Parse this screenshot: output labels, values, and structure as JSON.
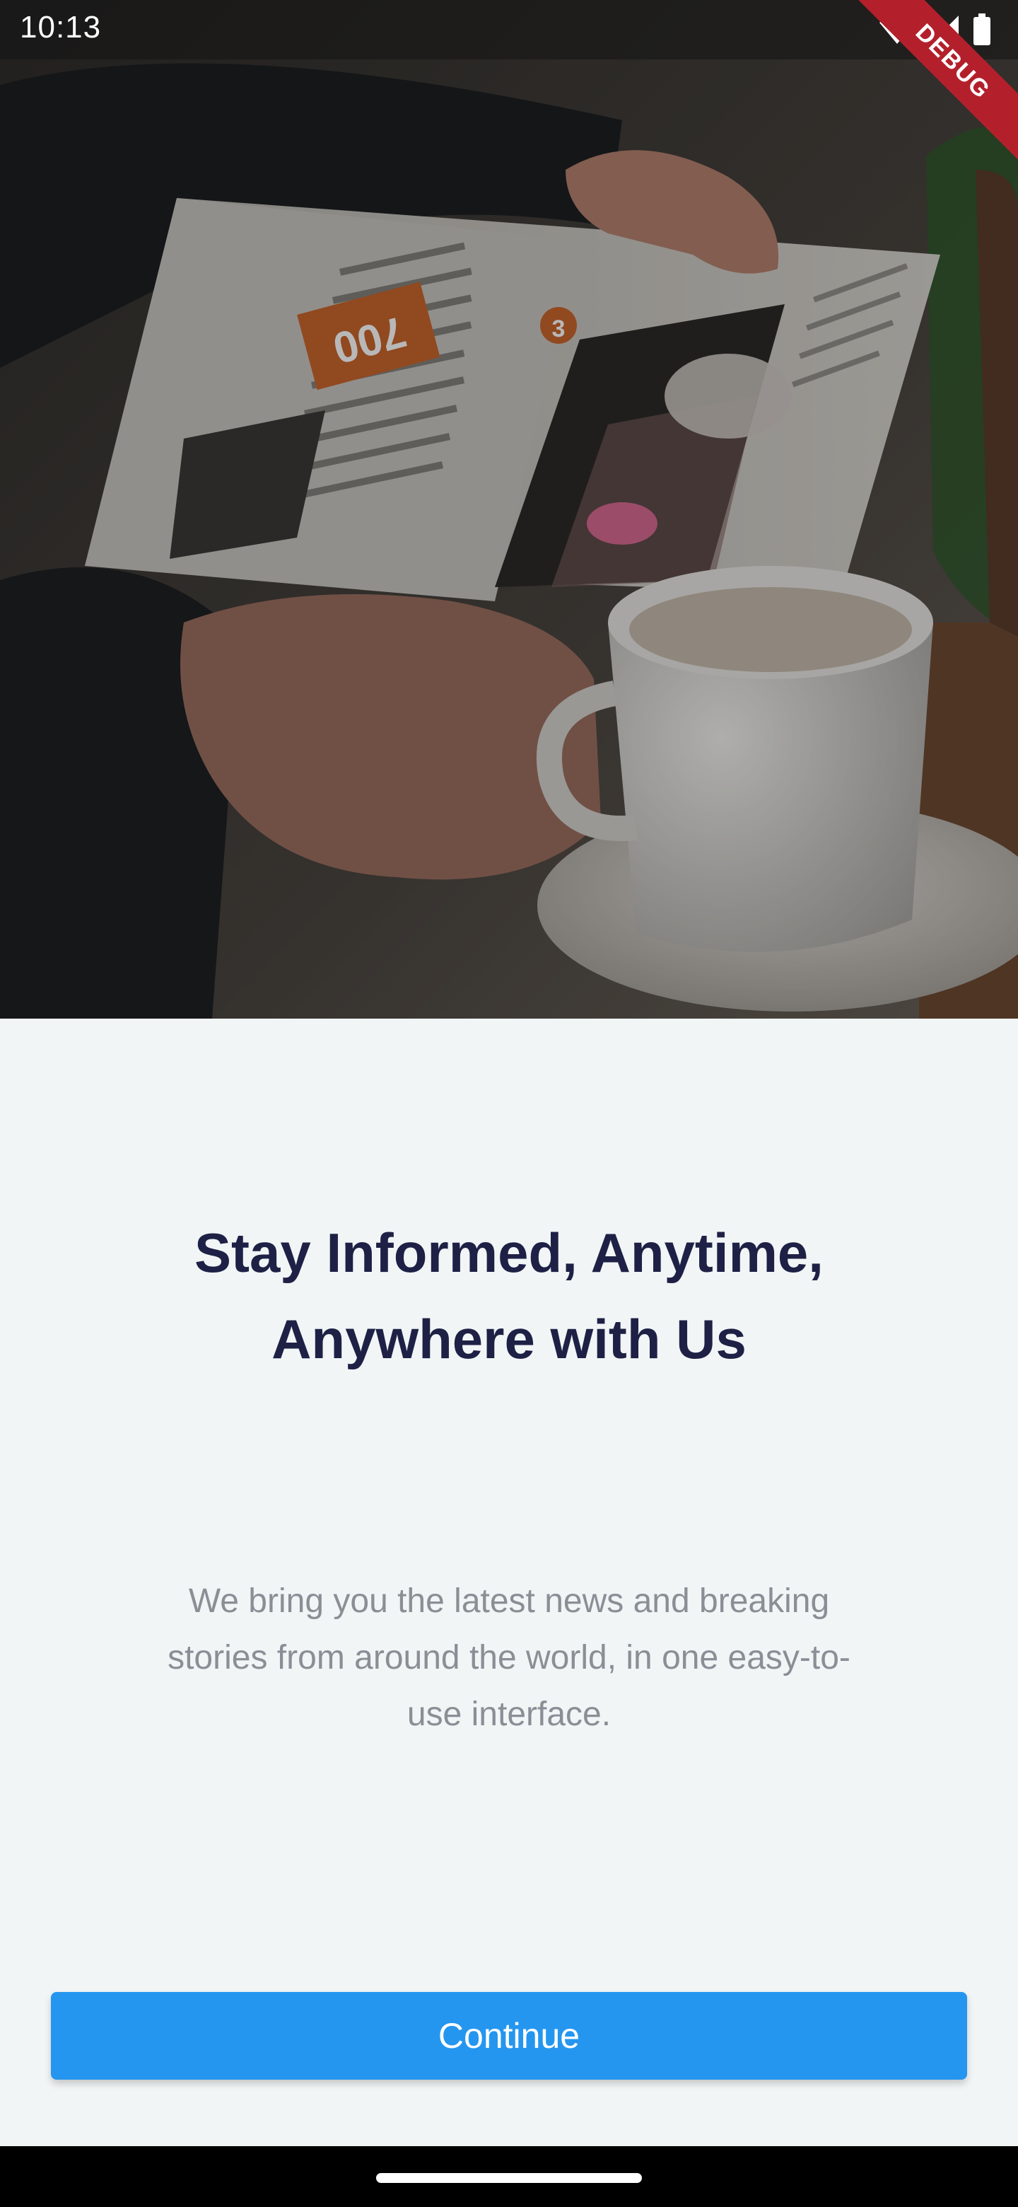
{
  "status_bar": {
    "time": "10:13",
    "debug_label": "DEBUG",
    "icons": [
      "wifi-icon",
      "cellular-signal-icon",
      "battery-icon"
    ]
  },
  "hero": {
    "image_subject": "hands holding an open newspaper beside a white coffee cup",
    "newspaper_number": "700",
    "newspaper_badge": "3"
  },
  "onboarding": {
    "headline": "Stay Informed, Anytime, Anywhere with Us",
    "description": "We bring you the latest news and breaking stories from around the world, in one easy-to-use interface.",
    "continue_label": "Continue"
  },
  "colors": {
    "background": "#f1f5f6",
    "headline": "#1e2145",
    "description": "#8a8f96",
    "button": "#2596ef",
    "button_text": "#ffffff",
    "debug_banner": "#b3202c"
  }
}
